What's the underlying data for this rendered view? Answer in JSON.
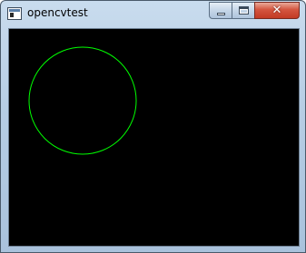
{
  "window": {
    "title": "opencvtest",
    "app_icon": "window-app-icon"
  },
  "controls": {
    "minimize_icon": "minimize-icon",
    "maximize_icon": "maximize-icon",
    "close_icon": "close-icon",
    "close_glyph": "✕"
  },
  "canvas": {
    "background_color": "#000000",
    "circle": {
      "stroke_color": "#00ff00"
    }
  }
}
